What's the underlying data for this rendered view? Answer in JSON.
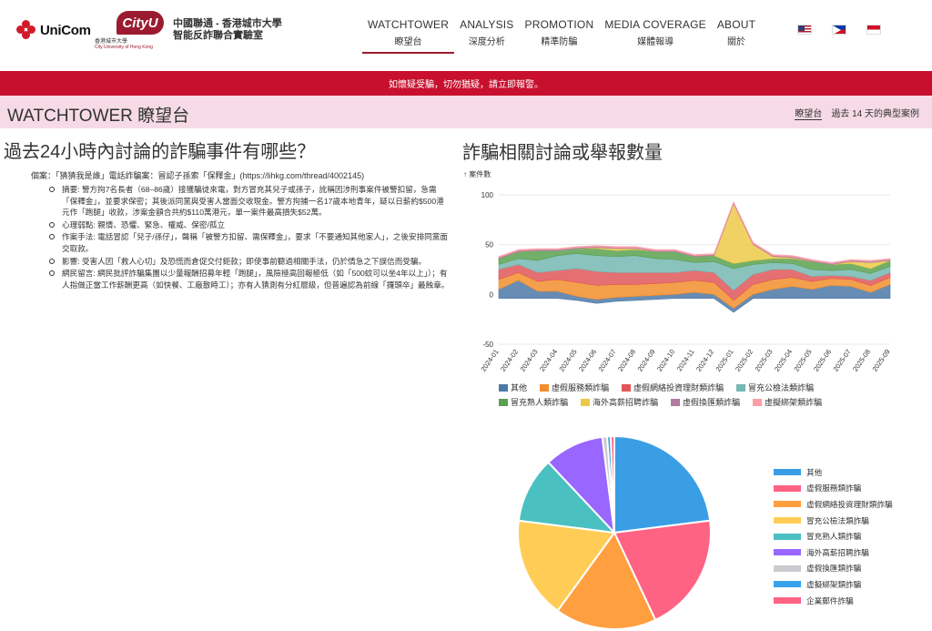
{
  "header": {
    "brand_unicom": "UniCom",
    "brand_cityu": "CityU",
    "cityu_cn": "香港城市大學",
    "cityu_en": "City University of Hong Kong",
    "lab_name_line1": "中國聯通 - 香港城市大學",
    "lab_name_line2": "智能反詐聯合實驗室",
    "nav": [
      {
        "en": "WATCHTOWER",
        "cn": "瞭望台"
      },
      {
        "en": "ANALYSIS",
        "cn": "深度分析"
      },
      {
        "en": "PROMOTION",
        "cn": "精準防騙"
      },
      {
        "en": "MEDIA COVERAGE",
        "cn": "媒體報導"
      },
      {
        "en": "ABOUT",
        "cn": "關於"
      }
    ],
    "flags": [
      "us-flag",
      "philippines-flag",
      "indonesia-flag"
    ]
  },
  "alert": "如懷疑受騙，切勿猶疑，請立即報警。",
  "title_bar": {
    "title": "WATCHTOWER 瞭望台",
    "link_active": "瞭望台",
    "link_other": "過去 14 天的典型案例"
  },
  "left": {
    "heading": "過去24小時內討論的詐騙事件有哪些？",
    "example": "個案：「猜猜我是誰」電話詐騙案：冒認子孫索「保釋金」(https://lihkg.com/thread/4002145)",
    "bullets": [
      "摘要: 警方拘7名長者（68–86歲）接獲騙徒來電，對方冒充其兒子或孫子，訛稱因涉刑事案件被警扣留，急需「保釋金」，並要求保密；其後派同黨與受害人當面交收現金。警方拘捕一名17歲本地青年，疑以日薪約$500港元作「跑腿」收款，涉案金額合共約$110萬港元，單一案件最高損失$52萬。",
      "心理弱點: 親情、恐懼、緊急、權威、保密/孤立",
      "作案手法: 電話冒認「兒子/孫仔」，聲稱「被警方扣留、需保釋金」，要求「不要通知其他家人」，之後安排同黨面交取款。",
      "影響: 受害人因「救人心切」及恐慌而倉促交付鉅款；即使事前聽過相關手法，仍於情急之下誤信而受騙。",
      "網民留言: 網民批評詐騙集團以少量報酬招募年輕「跑腿」，風險極高回報極低（如「500蚊可以坐4年以上」）；有人指做正當工作薪酬更高（如快餐、工廠散時工）；亦有人猜測有分紅層級，但普遍認為前線「攞頭卒」最蝕章。"
    ]
  },
  "chart_data": [
    {
      "type": "area",
      "title": "詐騙相關討論或舉報數量",
      "ylabel": "↑ 案件數",
      "ylim": [
        -50,
        110
      ],
      "yticks": [
        -50,
        0,
        50,
        100
      ],
      "x": [
        "2024-01",
        "2024-02",
        "2024-03",
        "2024-04",
        "2024-05",
        "2024-06",
        "2024-07",
        "2024-08",
        "2024-09",
        "2024-10",
        "2024-11",
        "2024-12",
        "2025-01",
        "2025-02",
        "2025-03",
        "2025-04",
        "2025-05",
        "2025-06",
        "2025-07",
        "2025-08",
        "2025-09"
      ],
      "series": [
        {
          "name": "其他",
          "color": "#4e79a7",
          "values": [
            5,
            14,
            3,
            3,
            -2,
            -5,
            -3,
            -2,
            -1,
            0,
            2,
            0,
            -14,
            0,
            5,
            8,
            5,
            9,
            8,
            2,
            10
          ]
        },
        {
          "name": "虛假服務類詐騙",
          "color": "#f28e2b",
          "values": [
            10,
            8,
            10,
            12,
            14,
            14,
            13,
            12,
            12,
            12,
            12,
            12,
            8,
            10,
            10,
            9,
            8,
            7,
            7,
            7,
            7
          ]
        },
        {
          "name": "虛假網絡投資理財類詐騙",
          "color": "#e15759",
          "values": [
            10,
            8,
            9,
            9,
            14,
            14,
            12,
            12,
            11,
            10,
            10,
            10,
            10,
            10,
            10,
            8,
            5,
            3,
            3,
            5,
            5
          ]
        },
        {
          "name": "冒充公檢法類詐騙",
          "color": "#76b7b2",
          "values": [
            5,
            6,
            12,
            15,
            15,
            16,
            16,
            17,
            14,
            13,
            8,
            11,
            22,
            10,
            7,
            6,
            7,
            5,
            7,
            7,
            6
          ]
        },
        {
          "name": "冒充熟人類詐騙",
          "color": "#59a14f",
          "values": [
            6,
            7,
            10,
            5,
            5,
            7,
            6,
            6,
            7,
            8,
            6,
            6,
            5,
            4,
            4,
            5,
            8,
            6,
            6,
            5,
            6
          ]
        },
        {
          "name": "海外高薪招聘詐騙",
          "color": "#edc948",
          "values": [
            0,
            0,
            0,
            0,
            0,
            1,
            2,
            1,
            0,
            0,
            0,
            0,
            60,
            16,
            2,
            1,
            0,
            0,
            2,
            6,
            0
          ]
        },
        {
          "name": "虛假換匯類詐騙",
          "color": "#b07aa1",
          "values": [
            1,
            1,
            1,
            1,
            1,
            1,
            1,
            1,
            1,
            1,
            1,
            1,
            1,
            1,
            1,
            1,
            1,
            1,
            1,
            1,
            1
          ]
        },
        {
          "name": "虛擬綁架類詐騙",
          "color": "#ff9da7",
          "values": [
            1,
            1,
            1,
            1,
            1,
            1,
            1,
            1,
            1,
            1,
            1,
            1,
            1,
            1,
            1,
            1,
            1,
            1,
            1,
            1,
            1
          ]
        }
      ]
    },
    {
      "type": "pie",
      "slices": [
        {
          "name": "其他",
          "value": 23,
          "color": "#3a9ee5"
        },
        {
          "name": "虛假服務類詐騙",
          "value": 20,
          "color": "#ff6384"
        },
        {
          "name": "虛假網絡投資理財類詐騙",
          "value": 17,
          "color": "#ff9f40"
        },
        {
          "name": "冒充公檢法類詐騙",
          "value": 17,
          "color": "#ffcd56"
        },
        {
          "name": "冒充熟人類詐騙",
          "value": 11,
          "color": "#4bc0c0"
        },
        {
          "name": "海外高薪招聘詐騙",
          "value": 10,
          "color": "#9966ff"
        },
        {
          "name": "虛假換匯類詐騙",
          "value": 0.8,
          "color": "#c9cbcf"
        },
        {
          "name": "虛擬綁架類詐騙",
          "value": 0.6,
          "color": "#36a2eb"
        },
        {
          "name": "企業郵件詐騙",
          "value": 0.6,
          "color": "#ff6384"
        }
      ]
    }
  ]
}
